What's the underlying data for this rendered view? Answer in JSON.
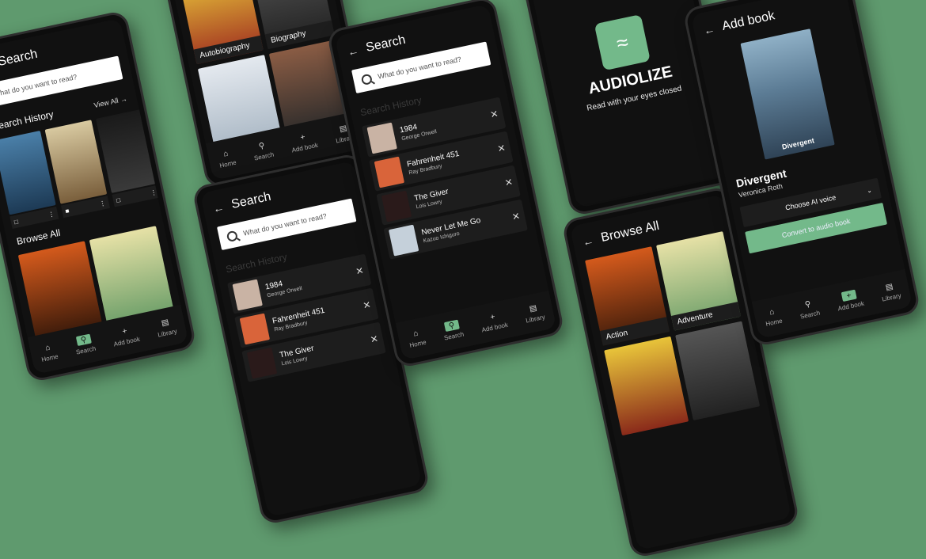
{
  "screens": {
    "search1": {
      "title": "Search",
      "placeholder": "What do you want to read?",
      "history_label": "Search History",
      "view_all": "View All",
      "browse_all": "Browse All"
    },
    "search_list": {
      "title": "Search",
      "placeholder": "What do you want to read?",
      "history_label": "Search History",
      "items": [
        {
          "title": "1984",
          "author": "George Orwell"
        },
        {
          "title": "Fahrenheit 451",
          "author": "Ray Bradbury"
        },
        {
          "title": "The Giver",
          "author": "Lois Lowry"
        },
        {
          "title": "Never Let Me Go",
          "author": "Kazuo Ishiguro"
        }
      ]
    },
    "categories": {
      "labels": [
        "Autobiography",
        "Biography"
      ]
    },
    "splash": {
      "brand": "AUDIOLIZE",
      "tagline": "Read with your eyes closed"
    },
    "browse": {
      "title": "Browse All",
      "tiles": [
        "Action",
        "Adventure"
      ]
    },
    "add_book": {
      "title": "Add book",
      "book_title": "Divergent",
      "book_author": "Veronica Roth",
      "choose_voice": "Choose AI voice",
      "convert": "Convert to audio book"
    }
  },
  "nav": {
    "items": [
      "Home",
      "Search",
      "Add book",
      "Library"
    ]
  },
  "colors": {
    "background": "#5f9a6e",
    "accent": "#73b98a",
    "phone": "#0d0d0d"
  }
}
